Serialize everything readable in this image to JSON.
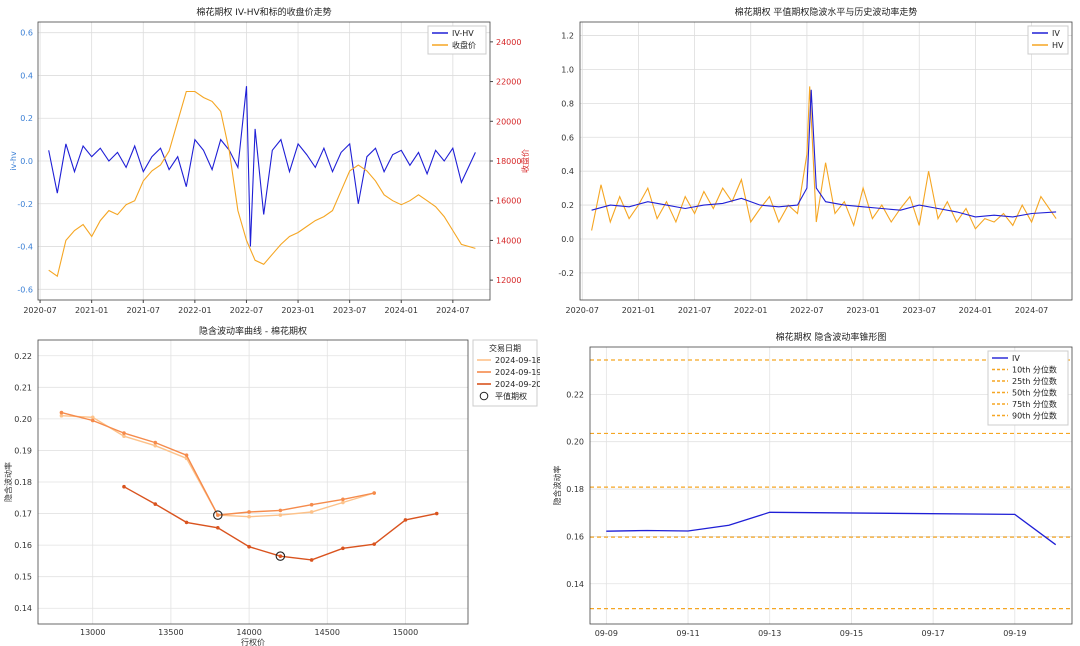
{
  "chart_data": [
    {
      "type": "line",
      "title": "棉花期权 IV-HV和标的收盘价走势",
      "xlabel": "",
      "ylabel": "iv-hv",
      "y2label": "收盘价",
      "x_ticks": [
        "2020-07",
        "2021-01",
        "2021-07",
        "2022-01",
        "2022-07",
        "2023-01",
        "2023-07",
        "2024-01",
        "2024-07"
      ],
      "y_ticks": [
        "-0.6",
        "-0.4",
        "-0.2",
        "0.0",
        "0.2",
        "0.4",
        "0.6"
      ],
      "y2_ticks": [
        "12000",
        "14000",
        "16000",
        "18000",
        "20000",
        "22000",
        "24000"
      ],
      "ylim": [
        -0.65,
        0.65
      ],
      "y2lim": [
        11000,
        25000
      ],
      "legend": [
        "IV-HV",
        "收盘价"
      ],
      "legend_position": "top-right",
      "grid": true,
      "series": [
        {
          "name": "IV-HV",
          "color": "#1f1fd6",
          "x": [
            "2020-08-01",
            "2020-09-01",
            "2020-10-01",
            "2020-11-01",
            "2020-12-01",
            "2021-01-01",
            "2021-02-01",
            "2021-03-01",
            "2021-04-01",
            "2021-05-01",
            "2021-06-01",
            "2021-07-01",
            "2021-08-01",
            "2021-09-01",
            "2021-10-01",
            "2021-11-01",
            "2021-12-01",
            "2022-01-01",
            "2022-02-01",
            "2022-03-01",
            "2022-04-01",
            "2022-05-01",
            "2022-06-01",
            "2022-07-01",
            "2022-07-15",
            "2022-08-01",
            "2022-09-01",
            "2022-10-01",
            "2022-11-01",
            "2022-12-01",
            "2023-01-01",
            "2023-02-01",
            "2023-03-01",
            "2023-04-01",
            "2023-05-01",
            "2023-06-01",
            "2023-07-01",
            "2023-08-01",
            "2023-09-01",
            "2023-10-01",
            "2023-11-01",
            "2023-12-01",
            "2024-01-01",
            "2024-02-01",
            "2024-03-01",
            "2024-04-01",
            "2024-05-01",
            "2024-06-01",
            "2024-07-01",
            "2024-08-01",
            "2024-09-20"
          ],
          "values": [
            0.05,
            -0.15,
            0.08,
            -0.05,
            0.07,
            0.02,
            0.06,
            0.0,
            0.04,
            -0.03,
            0.07,
            -0.05,
            0.02,
            0.06,
            -0.04,
            0.02,
            -0.12,
            0.1,
            0.05,
            -0.04,
            0.1,
            0.05,
            -0.03,
            0.35,
            -0.4,
            0.15,
            -0.25,
            0.05,
            0.1,
            -0.05,
            0.08,
            0.03,
            -0.03,
            0.06,
            -0.05,
            0.04,
            0.08,
            -0.2,
            0.02,
            0.06,
            -0.05,
            0.03,
            0.05,
            -0.02,
            0.04,
            -0.06,
            0.05,
            0.0,
            0.06,
            -0.1,
            0.04
          ]
        },
        {
          "name": "收盘价",
          "color": "#f5a623",
          "axis": "right",
          "x": [
            "2020-08-01",
            "2020-09-01",
            "2020-10-01",
            "2020-11-01",
            "2020-12-01",
            "2021-01-01",
            "2021-02-01",
            "2021-03-01",
            "2021-04-01",
            "2021-05-01",
            "2021-06-01",
            "2021-07-01",
            "2021-08-01",
            "2021-09-01",
            "2021-10-01",
            "2021-11-01",
            "2021-12-01",
            "2022-01-01",
            "2022-02-01",
            "2022-03-01",
            "2022-04-01",
            "2022-05-01",
            "2022-06-01",
            "2022-07-01",
            "2022-08-01",
            "2022-09-01",
            "2022-10-01",
            "2022-11-01",
            "2022-12-01",
            "2023-01-01",
            "2023-02-01",
            "2023-03-01",
            "2023-04-01",
            "2023-05-01",
            "2023-06-01",
            "2023-07-01",
            "2023-08-01",
            "2023-09-01",
            "2023-10-01",
            "2023-11-01",
            "2023-12-01",
            "2024-01-01",
            "2024-02-01",
            "2024-03-01",
            "2024-04-01",
            "2024-05-01",
            "2024-06-01",
            "2024-07-01",
            "2024-08-01",
            "2024-09-20"
          ],
          "values": [
            12500,
            12200,
            14000,
            14500,
            14800,
            14200,
            15000,
            15500,
            15300,
            15800,
            16000,
            17000,
            17500,
            17800,
            18500,
            20000,
            21500,
            21500,
            21200,
            21000,
            20500,
            18500,
            15500,
            14000,
            13000,
            12800,
            13300,
            13800,
            14200,
            14400,
            14700,
            15000,
            15200,
            15500,
            16500,
            17500,
            17800,
            17500,
            17000,
            16300,
            16000,
            15800,
            16000,
            16300,
            16000,
            15700,
            15200,
            14500,
            13800,
            13600
          ]
        }
      ]
    },
    {
      "type": "line",
      "title": "棉花期权 平值期权隐波水平与历史波动率走势",
      "xlabel": "",
      "ylabel": "",
      "x_ticks": [
        "2020-07",
        "2021-01",
        "2021-07",
        "2022-01",
        "2022-07",
        "2023-01",
        "2023-07",
        "2024-01",
        "2024-07"
      ],
      "y_ticks": [
        "-0.2",
        "0.0",
        "0.2",
        "0.4",
        "0.6",
        "0.8",
        "1.0",
        "1.2"
      ],
      "ylim": [
        -0.36,
        1.28
      ],
      "legend": [
        "IV",
        "HV"
      ],
      "legend_position": "top-right",
      "grid": true,
      "series": [
        {
          "name": "IV",
          "color": "#1f1fd6",
          "x": [
            "2020-08-01",
            "2020-10-01",
            "2020-12-01",
            "2021-02-01",
            "2021-04-01",
            "2021-06-01",
            "2021-08-01",
            "2021-10-01",
            "2021-12-01",
            "2022-02-01",
            "2022-04-01",
            "2022-06-01",
            "2022-07-01",
            "2022-07-15",
            "2022-08-01",
            "2022-09-01",
            "2022-11-01",
            "2023-01-01",
            "2023-03-01",
            "2023-05-01",
            "2023-07-01",
            "2023-09-01",
            "2023-11-01",
            "2024-01-01",
            "2024-03-01",
            "2024-05-01",
            "2024-07-01",
            "2024-09-20"
          ],
          "values": [
            0.17,
            0.2,
            0.19,
            0.22,
            0.2,
            0.18,
            0.2,
            0.21,
            0.24,
            0.2,
            0.19,
            0.2,
            0.3,
            0.88,
            0.3,
            0.22,
            0.2,
            0.19,
            0.18,
            0.17,
            0.2,
            0.18,
            0.16,
            0.13,
            0.14,
            0.13,
            0.15,
            0.16
          ]
        },
        {
          "name": "HV",
          "color": "#f5a623",
          "x": [
            "2020-08-01",
            "2020-09-01",
            "2020-10-01",
            "2020-11-01",
            "2020-12-01",
            "2021-01-01",
            "2021-02-01",
            "2021-03-01",
            "2021-04-01",
            "2021-05-01",
            "2021-06-01",
            "2021-07-01",
            "2021-08-01",
            "2021-09-01",
            "2021-10-01",
            "2021-11-01",
            "2021-12-01",
            "2022-01-01",
            "2022-02-01",
            "2022-03-01",
            "2022-04-01",
            "2022-05-01",
            "2022-06-01",
            "2022-07-01",
            "2022-07-10",
            "2022-08-01",
            "2022-09-01",
            "2022-10-01",
            "2022-11-01",
            "2022-12-01",
            "2023-01-01",
            "2023-02-01",
            "2023-03-01",
            "2023-04-01",
            "2023-05-01",
            "2023-06-01",
            "2023-07-01",
            "2023-08-01",
            "2023-09-01",
            "2023-10-01",
            "2023-11-01",
            "2023-12-01",
            "2024-01-01",
            "2024-02-01",
            "2024-03-01",
            "2024-04-01",
            "2024-05-01",
            "2024-06-01",
            "2024-07-01",
            "2024-08-01",
            "2024-09-20"
          ],
          "values": [
            0.05,
            0.32,
            0.1,
            0.25,
            0.12,
            0.2,
            0.3,
            0.12,
            0.22,
            0.1,
            0.25,
            0.15,
            0.28,
            0.18,
            0.3,
            0.22,
            0.35,
            0.1,
            0.18,
            0.25,
            0.1,
            0.2,
            0.15,
            0.5,
            0.9,
            0.1,
            0.45,
            0.15,
            0.22,
            0.08,
            0.3,
            0.12,
            0.2,
            0.1,
            0.18,
            0.25,
            0.08,
            0.4,
            0.12,
            0.22,
            0.1,
            0.18,
            0.06,
            0.12,
            0.1,
            0.15,
            0.08,
            0.2,
            0.1,
            0.25,
            0.12
          ]
        }
      ]
    },
    {
      "type": "line",
      "title": "隐含波动率曲线 - 棉花期权",
      "xlabel": "行权价",
      "ylabel": "隐含波动率",
      "x_ticks": [
        "13000",
        "13500",
        "14000",
        "14500",
        "15000"
      ],
      "y_ticks": [
        "0.14",
        "0.15",
        "0.16",
        "0.17",
        "0.18",
        "0.19",
        "0.20",
        "0.21",
        "0.22"
      ],
      "xlim": [
        12650,
        15400
      ],
      "ylim": [
        0.135,
        0.225
      ],
      "legend_title": "交易日期",
      "legend": [
        "2024-09-18",
        "2024-09-19",
        "2024-09-20",
        "平值期权"
      ],
      "legend_position": "outside-right",
      "grid": true,
      "series": [
        {
          "name": "2024-09-18",
          "color": "#fdc28a",
          "x": [
            12800,
            13000,
            13200,
            13400,
            13600,
            13800,
            14000,
            14200,
            14400,
            14600,
            14800
          ],
          "values": [
            0.201,
            0.2005,
            0.1945,
            0.1915,
            0.1875,
            0.1695,
            0.169,
            0.1695,
            0.1705,
            0.1735,
            0.1765
          ]
        },
        {
          "name": "2024-09-19",
          "color": "#f58b4c",
          "x": [
            12800,
            13000,
            13200,
            13400,
            13600,
            13800,
            14000,
            14200,
            14400,
            14600,
            14800
          ],
          "values": [
            0.202,
            0.1995,
            0.1955,
            0.1925,
            0.1885,
            0.1695,
            0.1705,
            0.171,
            0.1728,
            0.1745,
            0.1765
          ]
        },
        {
          "name": "2024-09-20",
          "color": "#d9531e",
          "x": [
            13200,
            13400,
            13600,
            13800,
            14000,
            14200,
            14400,
            14600,
            14800,
            15000,
            15200
          ],
          "values": [
            0.1785,
            0.173,
            0.1672,
            0.1655,
            0.1595,
            0.1565,
            0.1553,
            0.159,
            0.1603,
            0.168,
            0.17
          ]
        }
      ],
      "atm_points": [
        {
          "x": 13800,
          "y": 0.1695
        },
        {
          "x": 14200,
          "y": 0.1565
        }
      ]
    },
    {
      "type": "line",
      "title": "棉花期权 隐含波动率锥形图",
      "xlabel": "",
      "ylabel": "隐含波动率",
      "x_ticks": [
        "09-09",
        "09-11",
        "09-13",
        "09-15",
        "09-17",
        "09-19"
      ],
      "y_ticks": [
        "0.14",
        "0.16",
        "0.18",
        "0.20",
        "0.22"
      ],
      "ylim": [
        0.123,
        0.24
      ],
      "legend": [
        "IV",
        "10th 分位数",
        "25th 分位数",
        "50th 分位数",
        "75th 分位数",
        "90th 分位数"
      ],
      "legend_position": "top-right",
      "grid": true,
      "series": [
        {
          "name": "IV",
          "color": "#1f1fd6",
          "x": [
            "09-09",
            "09-10",
            "09-11",
            "09-12",
            "09-13",
            "09-19",
            "09-20"
          ],
          "values": [
            0.1622,
            0.1625,
            0.1623,
            0.1647,
            0.1702,
            0.1693,
            0.1565
          ]
        }
      ],
      "percentiles": [
        {
          "name": "10th 分位数",
          "value": 0.1295
        },
        {
          "name": "25th 分位数",
          "value": 0.1597
        },
        {
          "name": "50th 分位数",
          "value": 0.1808
        },
        {
          "name": "75th 分位数",
          "value": 0.2035
        },
        {
          "name": "90th 分位数",
          "value": 0.2345
        }
      ],
      "percentile_color": "#f5a623"
    }
  ]
}
